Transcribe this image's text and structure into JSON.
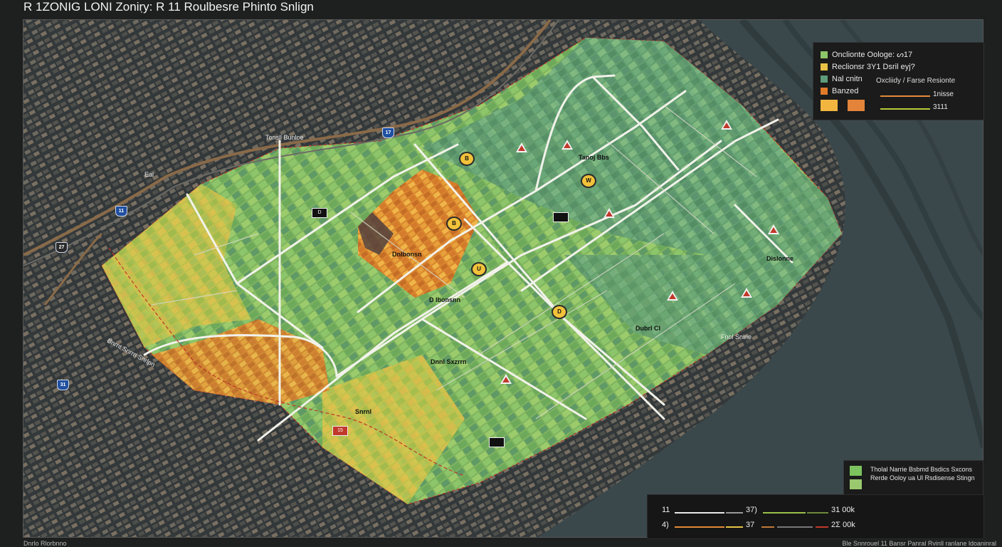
{
  "title": "R 1ZONIG LONI Zoniṛy: R 11 Roulbesre Phinto Snlign",
  "legend": {
    "items": [
      {
        "label": "Onclionte Oologe: ᔕ17",
        "color": "#8cc56a"
      },
      {
        "label": "Reclionsr 3Y1 Dsril eyj?",
        "color": "#e8c244"
      },
      {
        "label": "Nal cnitn",
        "color": "#5d9b7a"
      },
      {
        "label": "Banzed",
        "color": "#e07b2a"
      }
    ],
    "note": "Oxcliidy / Farse Resionte",
    "line_values": [
      "1nisse",
      "3111"
    ],
    "swatch_colors": [
      "#f2b640",
      "#e3843a"
    ],
    "line_colors": [
      "#e38a3a",
      "#b9c93a"
    ]
  },
  "small_legend": {
    "text": "Tholal Narrie Bsbmd Bsdics Sxcons Rerde Ooloy ua Ul Rsdisense Stingn",
    "colors": [
      "#7cc25e",
      "#9ac86e"
    ]
  },
  "scalebar": {
    "row1": {
      "left": "11",
      "mid": "37)",
      "right": "31 00k"
    },
    "row2": {
      "left": "4)",
      "mid": "37",
      "right": "2Σ 00k"
    }
  },
  "footer": {
    "left": "Dnrlo Rlorbnno",
    "right": "Ble Snnrouel 11 Bansr Panral Rvinll ranlane ldoaninral"
  },
  "map_labels": {
    "district": "Dnlbonsn",
    "center": "D lbonsnn",
    "se": "Dislonne",
    "river": "Fnol Snine",
    "west": "Bnrnt Snrrn Snrlpn",
    "ne_a": "Tanoj Bbs",
    "ne_b": "Dubrl Cl",
    "mid_a": "Dnnl Sxzrrn",
    "mid_b": "Snrnl",
    "tl": "Tonsll Bunloe",
    "tl2": "Eal"
  },
  "shields": [
    "17",
    "11",
    "31",
    "27"
  ],
  "markers": {
    "pins": [
      "B",
      "W",
      "U",
      "D",
      "B"
    ],
    "signs": [
      "15",
      "D"
    ]
  },
  "colors": {
    "residential": "#8cc56a",
    "commercial": "#e8c244",
    "mixed": "#5d9b7a",
    "industrial": "#e07b2a",
    "water": "#38464a",
    "urban": "#3b3f3d"
  }
}
